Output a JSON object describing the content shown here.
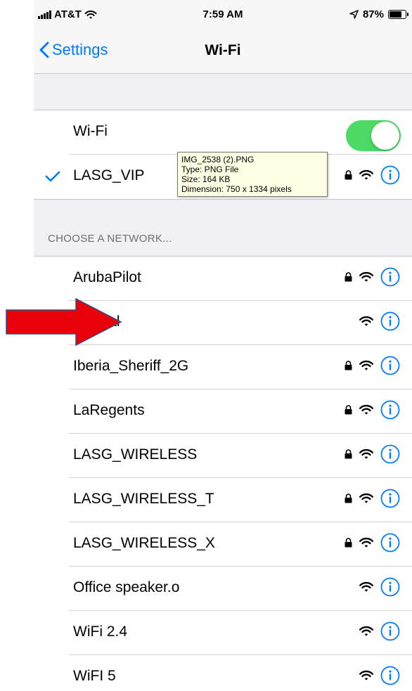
{
  "status_bar": {
    "carrier": "AT&T",
    "time": "7:59 AM",
    "battery_percent": "87%",
    "battery_level": 0.87
  },
  "nav": {
    "back_label": "Settings",
    "title": "Wi-Fi"
  },
  "wifi_toggle": {
    "label": "Wi-Fi",
    "on": true
  },
  "connected": {
    "name": "LASG_VIP"
  },
  "section_header": "CHOOSE A NETWORK...",
  "networks": [
    {
      "name": "ArubaPilot",
      "secured": true
    },
    {
      "name": "_Portal",
      "secured": false
    },
    {
      "name": "Iberia_Sheriff_2G",
      "secured": true
    },
    {
      "name": "LaRegents",
      "secured": true
    },
    {
      "name": "LASG_WIRELESS",
      "secured": true
    },
    {
      "name": "LASG_WIRELESS_T",
      "secured": true
    },
    {
      "name": "LASG_WIRELESS_X",
      "secured": true
    },
    {
      "name": "Office speaker.o",
      "secured": false
    },
    {
      "name": "WiFi 2.4",
      "secured": false
    },
    {
      "name": "WiFI 5",
      "secured": false
    }
  ],
  "tooltip": {
    "filename": "IMG_2538 (2).PNG",
    "type": "Type: PNG File",
    "size": "Size: 164 KB",
    "dimension": "Dimension: 750 x 1334 pixels"
  },
  "colors": {
    "accent": "#007aff",
    "toggle_on": "#4cd964",
    "arrow": "#e8000b"
  },
  "icons": {
    "back": "chevron-left-icon",
    "check": "checkmark-icon",
    "lock": "lock-icon",
    "wifi": "wifi-icon",
    "info": "info-icon",
    "arrow": "red-arrow-icon"
  }
}
